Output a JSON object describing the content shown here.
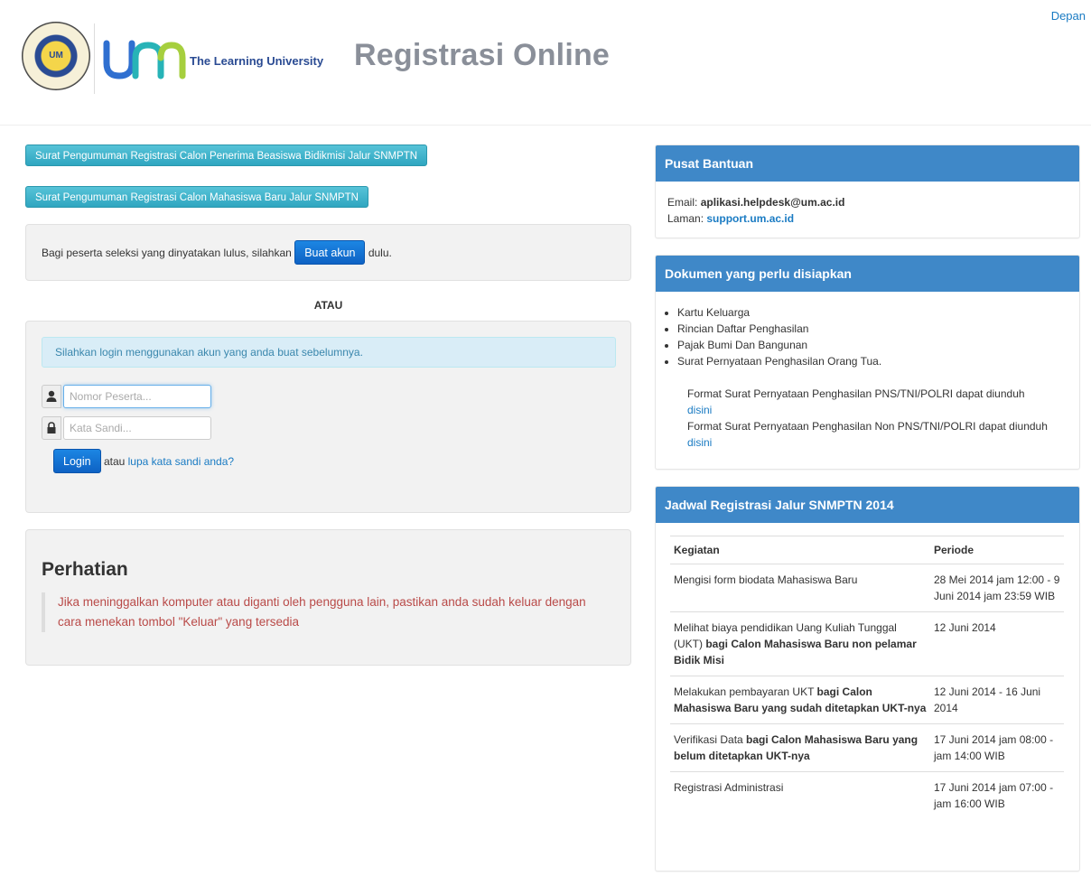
{
  "nav": {
    "home_link": "Depan"
  },
  "header": {
    "seal_text": "UM",
    "tagline": "The Learning University",
    "title": "Registrasi Online"
  },
  "announcements": {
    "bidikmisi": "Surat Pengumuman Registrasi Calon Penerima Beasiswa Bidikmisi Jalur SNMPTN",
    "reguler": "Surat Pengumuman Registrasi Calon Mahasiswa Baru Jalur SNMPTN"
  },
  "register": {
    "text_before": "Bagi peserta seleksi yang dinyatakan lulus, silahkan",
    "button": "Buat akun",
    "text_after": "dulu."
  },
  "separator": "ATAU",
  "login": {
    "info": "Silahkan login menggunakan akun yang anda buat sebelumnya.",
    "username_placeholder": "Nomor Peserta...",
    "password_placeholder": "Kata Sandi...",
    "button": "Login",
    "or_text": "atau",
    "forgot_link": "lupa kata sandi anda?"
  },
  "notice": {
    "title": "Perhatian",
    "text": "Jika meninggalkan komputer atau diganti oleh pengguna lain, pastikan anda sudah keluar dengan cara menekan tombol \"Keluar\" yang tersedia"
  },
  "help": {
    "title": "Pusat Bantuan",
    "email_label": "Email:",
    "email": "aplikasi.helpdesk@um.ac.id",
    "site_label": "Laman:",
    "site": "support.um.ac.id"
  },
  "documents": {
    "title": "Dokumen yang perlu disiapkan",
    "items": [
      "Kartu Keluarga",
      "Rincian Daftar Penghasilan",
      "Pajak Bumi Dan Bangunan",
      "Surat Pernyataan Penghasilan Orang Tua."
    ],
    "format1": "Format Surat Pernyataan Penghasilan PNS/TNI/POLRI dapat diunduh",
    "format1_link": "disini",
    "format2": "Format Surat Pernyataan Penghasilan Non PNS/TNI/POLRI dapat diunduh",
    "format2_link": "disini"
  },
  "schedule": {
    "title": "Jadwal Registrasi Jalur SNMPTN 2014",
    "col_activity": "Kegiatan",
    "col_period": "Periode",
    "rows": [
      {
        "activity": "Mengisi form biodata Mahasiswa Baru",
        "activity_bold": "",
        "period": "28 Mei 2014 jam 12:00 - 9 Juni 2014 jam 23:59 WIB"
      },
      {
        "activity": "Melihat biaya pendidikan Uang Kuliah Tunggal (UKT)",
        "activity_bold": "bagi Calon Mahasiswa Baru non pelamar Bidik Misi",
        "period": "12 Juni 2014"
      },
      {
        "activity": "Melakukan pembayaran UKT",
        "activity_bold": "bagi Calon Mahasiswa Baru yang sudah ditetapkan UKT-nya",
        "period": "12 Juni 2014 - 16 Juni 2014"
      },
      {
        "activity": "Verifikasi Data",
        "activity_bold": "bagi Calon Mahasiswa Baru yang belum ditetapkan UKT-nya",
        "period": "17 Juni 2014 jam 08:00 - jam 14:00 WIB"
      },
      {
        "activity": "Registrasi Administrasi",
        "activity_bold": "",
        "period": "17 Juni 2014 jam 07:00 - jam 16:00 WIB"
      }
    ]
  }
}
